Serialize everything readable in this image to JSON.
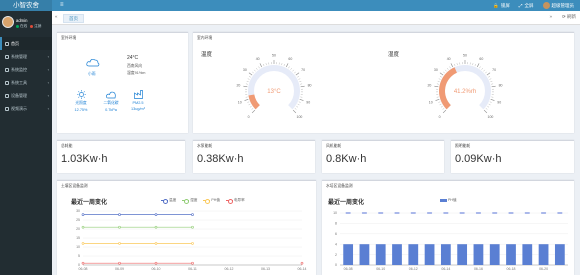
{
  "app": {
    "logo": "小智农舍",
    "topbar": {
      "menu_icon": "≡",
      "lock": "锁屏",
      "fullscreen": "全屏",
      "user": "超级管理员"
    }
  },
  "sidebar": {
    "user": {
      "name": "admin",
      "online": "在线",
      "logout": "注销"
    },
    "items": [
      {
        "label": "首页",
        "active": true,
        "has_children": false
      },
      {
        "label": "系统管理",
        "has_children": true
      },
      {
        "label": "系统监控",
        "has_children": true
      },
      {
        "label": "系统工具",
        "has_children": true
      },
      {
        "label": "设备管理",
        "has_children": true
      },
      {
        "label": "视频演示",
        "has_children": true
      }
    ]
  },
  "tabs": {
    "prev": "«",
    "home": "首页",
    "next": "»",
    "refresh": "⟳ 刷新"
  },
  "env": {
    "title": "室外环境",
    "weather": "小雨",
    "temp": "24°C",
    "wind": "西南风向",
    "humidity": "湿度91%m",
    "cells": [
      {
        "label": "光照度",
        "value": "12.75%"
      },
      {
        "label": "二氧化碳",
        "value": "0.7kPa"
      },
      {
        "label": "PM2.5",
        "value": "13ug/m³"
      }
    ]
  },
  "indoor": {
    "title": "室内环境",
    "gauges": [
      {
        "label": "温度",
        "value": 13,
        "max": 100,
        "display": "13°C"
      },
      {
        "label": "湿度",
        "value": 41.2,
        "max": 100,
        "display": "41.2%rh"
      }
    ],
    "ticks": [
      "0",
      "10",
      "20",
      "30",
      "40",
      "50",
      "60",
      "70",
      "80",
      "90",
      "100"
    ]
  },
  "energy": [
    {
      "label": "总耗能",
      "value": "1.03Kw·h"
    },
    {
      "label": "水泵能耗",
      "value": "0.38Kw·h"
    },
    {
      "label": "风机能耗",
      "value": "0.8Kw·h"
    },
    {
      "label": "照明能耗",
      "value": "0.09Kw·h"
    }
  ],
  "line_panel": {
    "title": "土壤区设备监测"
  },
  "bar_panel": {
    "title": "水培区设备监测"
  },
  "colors": {
    "primary": "#3c8dbc",
    "gauge_fill": "#f09a74",
    "bar": "#5a7fd3",
    "sidebar": "#222d32"
  },
  "chart_data": [
    {
      "type": "line",
      "title": "最近一周变化",
      "categories": [
        "06-08",
        "06-09",
        "06-10",
        "06-11",
        "06-12",
        "06-13",
        "06-14"
      ],
      "series": [
        {
          "name": "温度",
          "color": "#5470c6",
          "values": [
            28,
            28,
            28,
            28,
            null,
            null,
            null
          ]
        },
        {
          "name": "湿度",
          "color": "#91cc75",
          "values": [
            21,
            21,
            21,
            21,
            null,
            null,
            null
          ]
        },
        {
          "name": "PH值",
          "color": "#fac858",
          "values": [
            12,
            12,
            12,
            12,
            null,
            null,
            null
          ]
        },
        {
          "name": "电导率",
          "color": "#ee6666",
          "values": [
            1,
            1,
            1,
            1,
            null,
            null,
            1
          ]
        }
      ],
      "ylim": [
        0,
        30
      ],
      "yticks": [
        0,
        5,
        10,
        15,
        20,
        25,
        30
      ]
    },
    {
      "type": "bar",
      "title": "最近一周变化",
      "categories": [
        "06-08",
        "06-09",
        "06-10",
        "06-11",
        "06-12",
        "06-13",
        "06-14",
        "06-15",
        "06-16",
        "06-17",
        "06-18",
        "06-19",
        "06-20",
        "06-21"
      ],
      "series": [
        {
          "name": "PH值",
          "color": "#5a7fd3",
          "values": [
            4,
            4,
            4,
            4,
            4,
            4,
            4,
            4,
            4,
            4,
            4,
            4,
            4,
            4
          ]
        }
      ],
      "markers": [
        10,
        10,
        10,
        10,
        10,
        10,
        10,
        10,
        10,
        10,
        10,
        10,
        10,
        10
      ],
      "ylim": [
        0,
        10
      ],
      "yticks": [
        0,
        2,
        4,
        6,
        8,
        10
      ]
    }
  ]
}
